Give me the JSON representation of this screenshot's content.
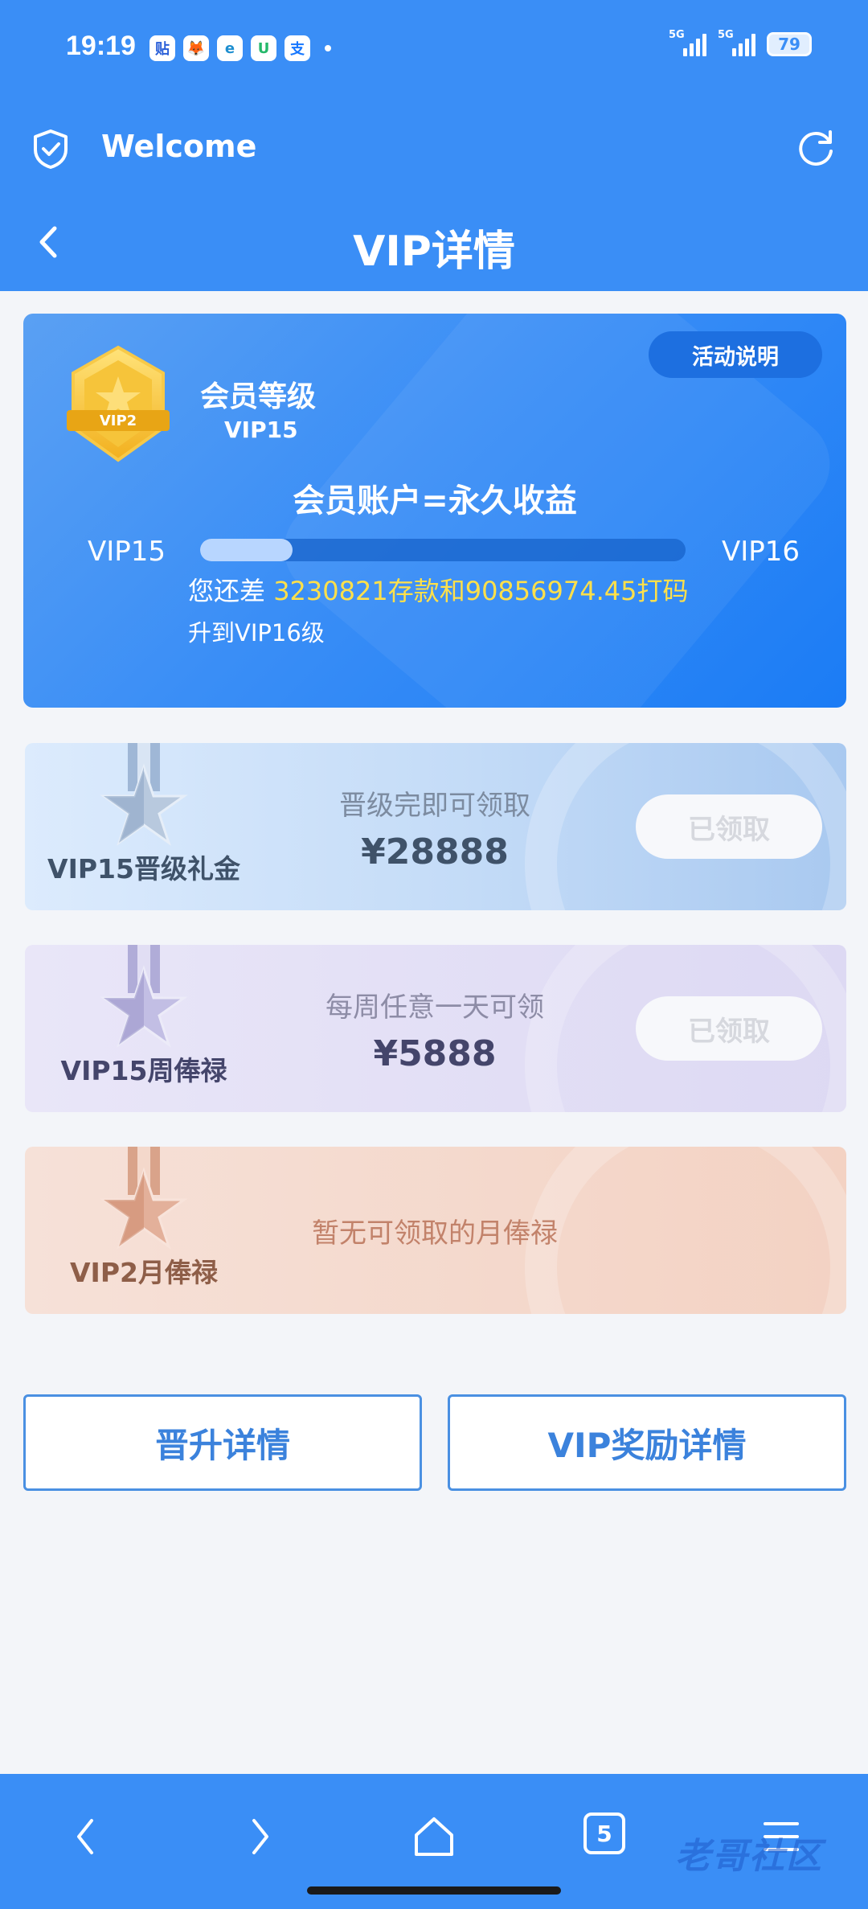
{
  "status_bar": {
    "time": "19:19",
    "notification_icons": [
      "贴",
      "🦊",
      "e",
      "U",
      "支"
    ],
    "signal_1": "5G",
    "signal_2": "5G",
    "battery": "79"
  },
  "browser": {
    "site_name": "Welcome",
    "tab_count": "5"
  },
  "header": {
    "title": "VIP详情"
  },
  "vip_card": {
    "activity_button": "活动说明",
    "badge_text": "VIP2",
    "level_title": "会员等级",
    "level_value": "VIP15",
    "slogan": "会员账户=永久收益",
    "current_level": "VIP15",
    "next_level": "VIP16",
    "progress": 0.19,
    "gap_prefix": "您还差",
    "gap_highlight": "3230821存款和90856974.45打码",
    "gap_suffix": "升到VIP16级"
  },
  "rewards": [
    {
      "name": "VIP15晋级礼金",
      "desc": "晋级完即可领取",
      "amount": "¥28888",
      "button": "已领取"
    },
    {
      "name": "VIP15周俸禄",
      "desc": "每周任意一天可领",
      "amount": "¥5888",
      "button": "已领取"
    },
    {
      "name": "VIP2月俸禄",
      "desc": "暂无可领取的月俸禄"
    }
  ],
  "buttons": {
    "promotion_details": "晋升详情",
    "vip_reward_details": "VIP奖励详情"
  },
  "watermark": "老哥社区",
  "colors": {
    "primary": "#3a8ef6",
    "highlight": "#ffe04a",
    "button_outline": "#4a90e2"
  }
}
